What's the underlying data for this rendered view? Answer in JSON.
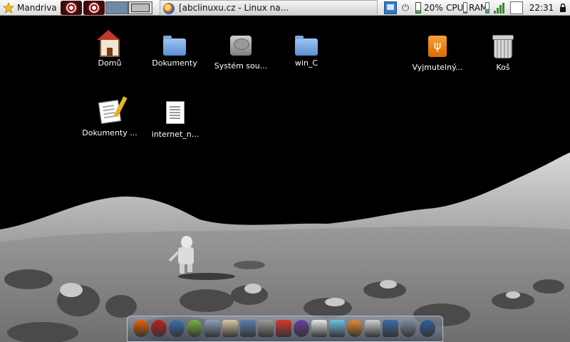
{
  "panel": {
    "menu_label": "Mandriva",
    "task_title": "[abclinuxu.cz - Linux na...",
    "battery": "20%",
    "cpu_label": "CPU",
    "ram_label": "RAM",
    "clock": "22:31",
    "icons": [
      "star-icon",
      "eye-icon",
      "eye-icon",
      "network-icon",
      "power-icon",
      "battery-icon",
      "signal-icon",
      "window-icon",
      "lock-icon"
    ]
  },
  "desktop": {
    "icons": [
      {
        "label": "Domů",
        "icon": "home-icon"
      },
      {
        "label": "Dokumenty",
        "icon": "folder-icon"
      },
      {
        "label": "Systém sou...",
        "icon": "hard-disk-icon"
      },
      {
        "label": "win_C",
        "icon": "folder-icon"
      },
      {
        "label": "Vyjmutelný...",
        "icon": "usb-drive-icon"
      },
      {
        "label": "Koš",
        "icon": "trash-icon"
      },
      {
        "label": "Dokumenty ...",
        "icon": "documents-icon"
      },
      {
        "label": "internet_n...",
        "icon": "text-file-icon"
      }
    ]
  },
  "dock": {
    "items": [
      {
        "icon": "firefox-icon",
        "color": "#e66000"
      },
      {
        "icon": "opera-icon",
        "color": "#c0201b"
      },
      {
        "icon": "thunderbird-icon",
        "color": "#3b6fb6"
      },
      {
        "icon": "notes-icon",
        "color": "#7ab540"
      },
      {
        "icon": "files-icon",
        "color": "#8aa0b8"
      },
      {
        "icon": "editor-icon",
        "color": "#d8c9a0"
      },
      {
        "icon": "presentation-icon",
        "color": "#5a7fae"
      },
      {
        "icon": "calculator-icon",
        "color": "#9a9a9a"
      },
      {
        "icon": "flag-icon",
        "color": "#d5372b"
      },
      {
        "icon": "nvu-icon",
        "color": "#6b3fa0"
      },
      {
        "icon": "archiver-icon",
        "color": "#e8e8e8"
      },
      {
        "icon": "network-tool-icon",
        "color": "#6cc3e8"
      },
      {
        "icon": "vlc-icon",
        "color": "#e88a2a"
      },
      {
        "icon": "terminal-icon",
        "color": "#cfcfcf"
      },
      {
        "icon": "monitor-icon",
        "color": "#3d6aa8"
      },
      {
        "icon": "media-icon",
        "color": "#7a8aa0"
      },
      {
        "icon": "nvidia-icon",
        "color": "#2f5f9e"
      }
    ]
  }
}
